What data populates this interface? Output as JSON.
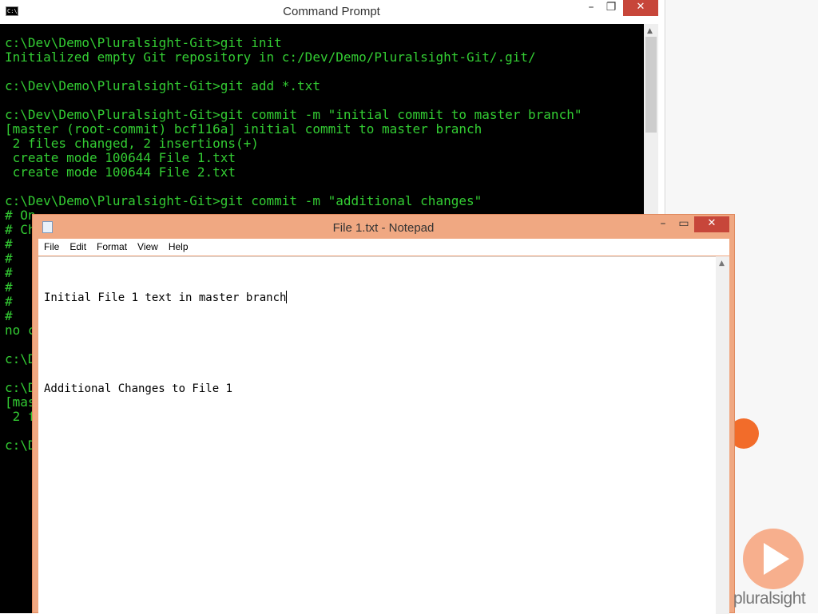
{
  "cmd": {
    "title": "Command Prompt",
    "icon_label": "C:\\.",
    "controls": {
      "minimize": "–",
      "maximize": "❐",
      "close": "✕"
    },
    "lines": [
      "c:\\Dev\\Demo\\Pluralsight-Git>git init",
      "Initialized empty Git repository in c:/Dev/Demo/Pluralsight-Git/.git/",
      "",
      "c:\\Dev\\Demo\\Pluralsight-Git>git add *.txt",
      "",
      "c:\\Dev\\Demo\\Pluralsight-Git>git commit -m \"initial commit to master branch\"",
      "[master (root-commit) bcf116a] initial commit to master branch",
      " 2 files changed, 2 insertions(+)",
      " create mode 100644 File 1.txt",
      " create mode 100644 File 2.txt",
      "",
      "c:\\Dev\\Demo\\Pluralsight-Git>git commit -m \"additional changes\"",
      "# On",
      "# Ch",
      "#",
      "#",
      "#",
      "#",
      "#",
      "#",
      "no c",
      "",
      "c:\\D",
      "",
      "c:\\D",
      "[mas",
      " 2 f",
      "",
      "c:\\D"
    ]
  },
  "notepad": {
    "title": "File 1.txt - Notepad",
    "controls": {
      "minimize": "–",
      "maximize": "▭",
      "close": "✕"
    },
    "menu": [
      "File",
      "Edit",
      "Format",
      "View",
      "Help"
    ],
    "lines": [
      "Initial File 1 text in master branch",
      "",
      "Additional Changes to File 1"
    ]
  },
  "branding": {
    "logo_text": "pluralsight"
  },
  "colors": {
    "console_text": "#33cc33",
    "console_bg": "#000000",
    "notepad_frame": "#f0a882",
    "close_button": "#c7463a",
    "brand_orange": "#f26c2a"
  }
}
